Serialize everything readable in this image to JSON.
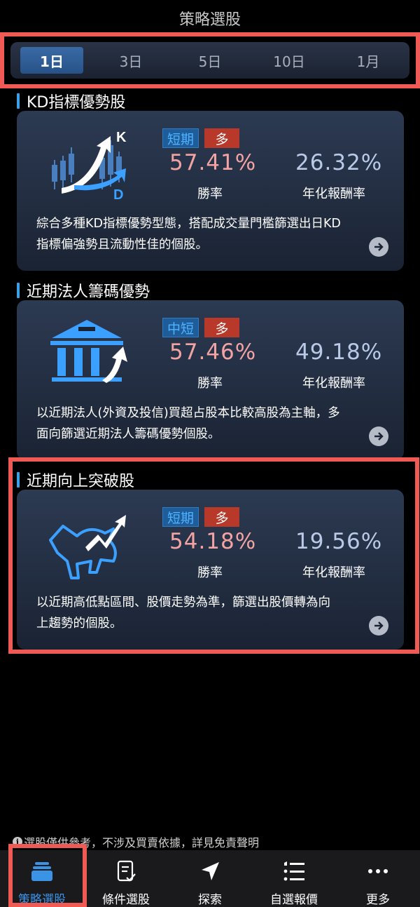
{
  "header": {
    "title": "策略選股"
  },
  "periods": [
    "1日",
    "3日",
    "5日",
    "10日",
    "1月"
  ],
  "strategies": [
    {
      "title": "KD指標優勢股",
      "icon": "kd-chart-icon",
      "term": "短期",
      "direction": "多",
      "win_rate": "57.41%",
      "win_rate_label": "勝率",
      "annual_return": "26.32%",
      "annual_return_label": "年化報酬率",
      "desc_line1": "綜合多種KD指標優勢型態，搭配成交量門檻篩選出日KD",
      "desc_line2": "指標偏強勢且流動性佳的個股。"
    },
    {
      "title": "近期法人籌碼優勢",
      "icon": "bank-icon",
      "term": "中短",
      "direction": "多",
      "win_rate": "57.46%",
      "win_rate_label": "勝率",
      "annual_return": "49.18%",
      "annual_return_label": "年化報酬率",
      "desc_line1": "以近期法人(外資及投信)買超占股本比較高股為主軸，多",
      "desc_line2": "面向篩選近期法人籌碼優勢個股。"
    },
    {
      "title": "近期向上突破股",
      "icon": "bull-icon",
      "term": "短期",
      "direction": "多",
      "win_rate": "54.18%",
      "win_rate_label": "勝率",
      "annual_return": "19.56%",
      "annual_return_label": "年化報酬率",
      "desc_line1": "以近期高低點區間、股價走勢為準，篩選出股價轉為向",
      "desc_line2": "上趨勢的個股。"
    }
  ],
  "disclaimer": "選股僅供參考，不涉及買賣依據，詳見免責聲明",
  "nav": [
    "策略選股",
    "條件選股",
    "探索",
    "自選報價",
    "更多"
  ],
  "colors": {
    "accent": "#3b93e6",
    "highlight": "#f05a54",
    "win": "#f4a3a3",
    "annual": "#b9c9e6"
  }
}
